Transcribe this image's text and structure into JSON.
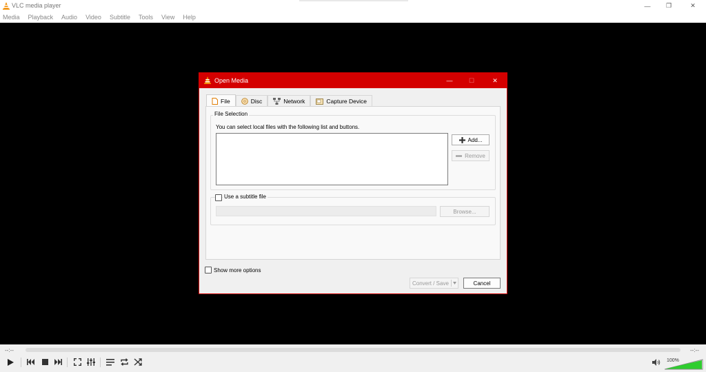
{
  "window": {
    "title": "VLC media player",
    "minimize_glyph": "—",
    "restore_glyph": "❐",
    "close_glyph": "✕"
  },
  "menu": [
    "Media",
    "Playback",
    "Audio",
    "Video",
    "Subtitle",
    "Tools",
    "View",
    "Help"
  ],
  "player": {
    "elapsed": "--:--",
    "remaining": "--:--",
    "volume": "100%",
    "volume_level": 1.0
  },
  "dialog": {
    "title": "Open Media",
    "tabs": [
      {
        "label": "File",
        "icon": "file-icon",
        "active": true
      },
      {
        "label": "Disc",
        "icon": "disc-icon",
        "active": false
      },
      {
        "label": "Network",
        "icon": "network-icon",
        "active": false
      },
      {
        "label": "Capture Device",
        "icon": "capture-device-icon",
        "active": false
      }
    ],
    "file_selection": {
      "group_label": "File Selection",
      "hint": "You can select local files with the following list and buttons.",
      "add_label": "Add...",
      "remove_label": "Remove"
    },
    "subtitle": {
      "checkbox_label": "Use a subtitle file",
      "checked": false,
      "browse_label": "Browse..."
    },
    "show_more_options": "Show more options",
    "convert_save_label": "Convert / Save",
    "cancel_label": "Cancel"
  },
  "colors": {
    "accent": "#d40000",
    "volume_fill": "#2fcd2f"
  }
}
